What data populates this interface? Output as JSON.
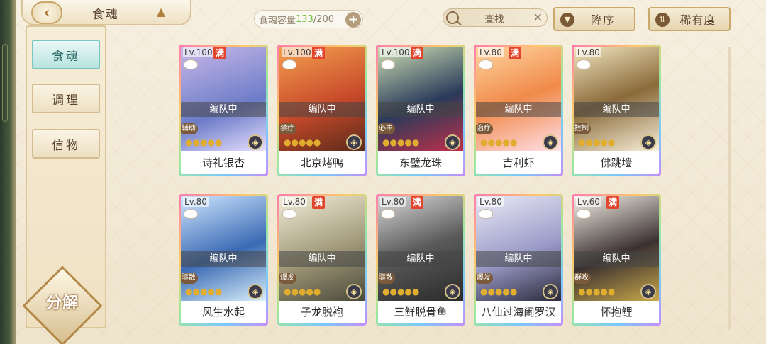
{
  "header": {
    "title": "食魂",
    "capacity_label": "食魂容量",
    "capacity_current": "133",
    "capacity_sep": "/200",
    "search_label": "查找",
    "sort_desc_label": "降序",
    "sort_rarity_label": "稀有度"
  },
  "sidebar": {
    "items": [
      {
        "label": "食魂",
        "active": true
      },
      {
        "label": "调理",
        "active": false
      },
      {
        "label": "信物",
        "active": false
      }
    ],
    "decompose_label": "分解"
  },
  "cards": [
    {
      "level": "Lv.100",
      "max": "满",
      "team": "编队中",
      "role": "辅助",
      "stars": "●●●●●",
      "name": "诗礼银杏",
      "bg": "linear-gradient(160deg,#c8b8e8,#6c7cc8 60%,#e8e0ff)"
    },
    {
      "level": "Lv.100",
      "max": "满",
      "team": "编队中",
      "role": "禁疗",
      "stars": "●●●●●",
      "name": "北京烤鸭",
      "bg": "linear-gradient(160deg,#f4a050,#c84a2a 55%,#5a2a1a)"
    },
    {
      "level": "Lv.100",
      "max": "满",
      "team": "编队中",
      "role": "必中",
      "stars": "●●●●●",
      "name": "东璧龙珠",
      "bg": "linear-gradient(160deg,#cfe0b4,#2a3a5a 55%,#c0304a)"
    },
    {
      "level": "Lv.80",
      "max": "满",
      "team": "编队中",
      "role": "治疗",
      "stars": "●●●●●",
      "name": "吉利虾",
      "bg": "linear-gradient(160deg,#ffd6a0,#f08a4a 50%,#ffe0ea)"
    },
    {
      "level": "Lv.80",
      "max": "",
      "team": "编队中",
      "role": "控制",
      "stars": "●●●●●",
      "name": "佛跳墙",
      "bg": "linear-gradient(160deg,#f2e6c0,#8a6a3a 50%,#f8f0da)"
    },
    {
      "level": "Lv.80",
      "max": "",
      "team": "编队中",
      "role": "驱散",
      "stars": "●●●●●",
      "name": "风生水起",
      "bg": "linear-gradient(160deg,#cfe6ff,#3a6ab4 55%,#d8eefa)"
    },
    {
      "level": "Lv.80",
      "max": "满",
      "team": "编队中",
      "role": "爆发",
      "stars": "●●●●●",
      "name": "子龙脱袍",
      "bg": "linear-gradient(160deg,#f2ecd8,#a09878 55%,#4a4a3a)"
    },
    {
      "level": "Lv.80",
      "max": "满",
      "team": "编队中",
      "role": "驱散",
      "stars": "●●●●●",
      "name": "三鲜脱骨鱼",
      "bg": "linear-gradient(160deg,#d8d8d8,#5a5a5a 50%,#2a2a2a)"
    },
    {
      "level": "Lv.80",
      "max": "",
      "team": "编队中",
      "role": "爆发",
      "stars": "●●●●●",
      "name": "八仙过海闹罗汉",
      "bg": "linear-gradient(160deg,#eaeaf6,#9a9ac8 55%,#2a2a3a)"
    },
    {
      "level": "Lv.60",
      "max": "满",
      "team": "编队中",
      "role": "群攻",
      "stars": "●●●●●",
      "name": "怀抱鲤",
      "bg": "linear-gradient(160deg,#f6f2ea,#3a3030 55%,#c8a84a)"
    }
  ]
}
